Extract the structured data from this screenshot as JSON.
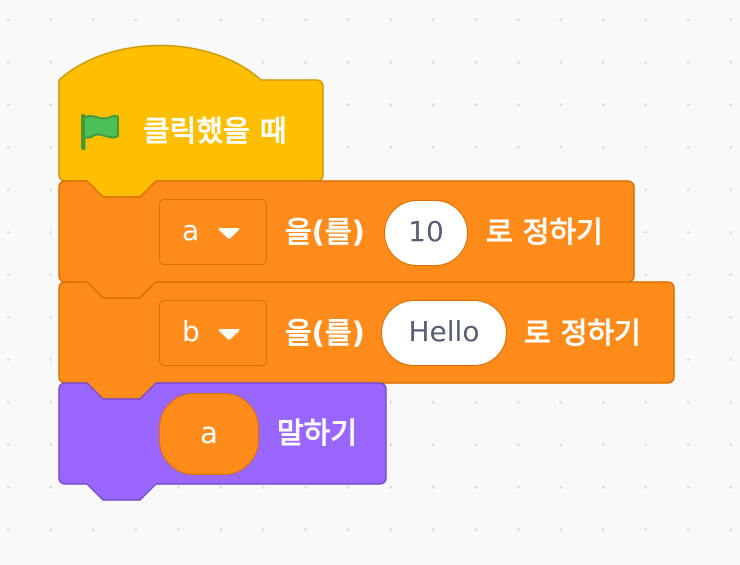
{
  "colors": {
    "event": "#ffbf00",
    "event_border": "#cc9900",
    "variables": "#ff8c1a",
    "variables_border": "#db6e00",
    "looks": "#9966ff",
    "looks_border": "#774dcb",
    "flag": "#4cbf56",
    "input_text": "#575e75"
  },
  "script": {
    "hat_block": {
      "icon": "green-flag-icon",
      "label": "클릭했을 때"
    },
    "set_a": {
      "variable": "a",
      "connector": "을(를)",
      "value": "10",
      "suffix": "로 정하기"
    },
    "set_b": {
      "variable": "b",
      "connector": "을(를)",
      "value": "Hello",
      "suffix": "로 정하기"
    },
    "say": {
      "reporter": "a",
      "label": "말하기"
    }
  }
}
